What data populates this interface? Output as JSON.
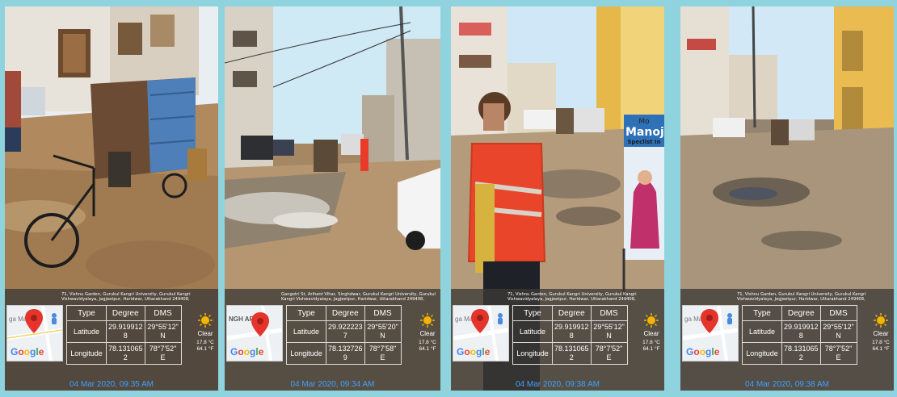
{
  "colors": {
    "frame": "#8fd3de",
    "timestamp": "#3da2ff",
    "pin": "#e5342b"
  },
  "panels": [
    {
      "address": "71, Vishnu Garden, Gurukul Kangri University, Gurukul Kangri Vishwavidyalaya, Jagjeetpur, Haridwar, Uttarakhand 249408,",
      "map_text": "ga Ma ar",
      "google": "Google",
      "headers": [
        "Type",
        "Degree",
        "DMS"
      ],
      "latitude": {
        "label": "Latitude",
        "degree": "29.919912 8",
        "dms": "29°55'12\" N"
      },
      "longitude": {
        "label": "Longitude",
        "degree": "78.131065 2",
        "dms": "78°7'52\" E"
      },
      "weather": {
        "condition": "Clear",
        "temp_c": "17.8 °C",
        "temp_f": "64.1 °F"
      },
      "timestamp": "04 Mar 2020, 09:35 AM"
    },
    {
      "address": "Gangotri St, Arihant Vihar, Singhdwar, Gurukul Kangri University, Gurukul Kangri Vishwavidyalaya, Jagjeetpur, Haridwar, Uttarakhand 249408,",
      "map_text": "NGH AR",
      "google": "Google",
      "headers": [
        "Type",
        "Degree",
        "DMS"
      ],
      "latitude": {
        "label": "Latitude",
        "degree": "29.922223 7",
        "dms": "29°55'20\" N"
      },
      "longitude": {
        "label": "Longitude",
        "degree": "78.132726 9",
        "dms": "78°7'58\" E"
      },
      "weather": {
        "condition": "Clear",
        "temp_c": "17.8 °C",
        "temp_f": "64.1 °F"
      },
      "timestamp": "04 Mar 2020, 09:34 AM"
    },
    {
      "address": "71, Vishnu Garden, Gurukul Kangri University, Gurukul Kangri Vishwavidyalaya, Jagjeetpur, Haridwar, Uttarakhand 249408,",
      "map_text": "ga Ma ar",
      "google": "Google",
      "headers": [
        "Type",
        "Degree",
        "DMS"
      ],
      "latitude": {
        "label": "Latitude",
        "degree": "29.919912 8",
        "dms": "29°55'12\" N"
      },
      "longitude": {
        "label": "Longitude",
        "degree": "78.131065 2",
        "dms": "78°7'52\" E"
      },
      "weather": {
        "condition": "Clear",
        "temp_c": "17.8 °C",
        "temp_f": "64.1 °F"
      },
      "timestamp": "04 Mar 2020, 09:38 AM"
    },
    {
      "address": "71, Vishnu Garden, Gurukul Kangri University, Gurukul Kangri Vishwavidyalaya, Jagjeetpur, Haridwar, Uttarakhand 249408,",
      "map_text": "ga Ma ar",
      "google": "Google",
      "headers": [
        "Type",
        "Degree",
        "DMS"
      ],
      "latitude": {
        "label": "Latitude",
        "degree": "29.919912 8",
        "dms": "29°55'12\" N"
      },
      "longitude": {
        "label": "Longitude",
        "degree": "78.131065 2",
        "dms": "78°7'52\" E"
      },
      "weather": {
        "condition": "Clear",
        "temp_c": "17.8 °C",
        "temp_f": "64.1 °F"
      },
      "timestamp": "04 Mar 2020, 09:38 AM"
    }
  ],
  "signboard": {
    "line1": "Mo",
    "line2": "Manoj",
    "line3": "Speclist In"
  }
}
